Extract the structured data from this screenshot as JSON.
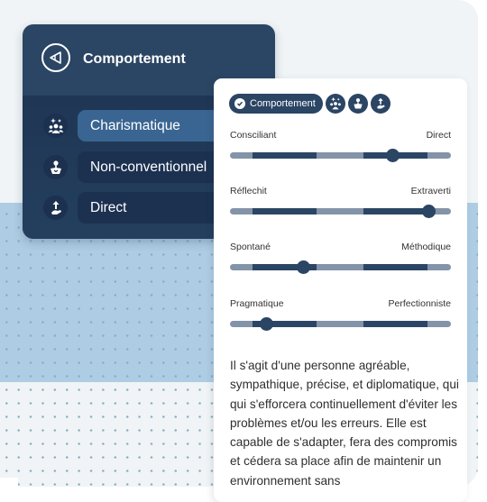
{
  "panel": {
    "title": "Comportement",
    "logo_icon": "triangle-logo-icon",
    "traits": [
      {
        "label": "Charismatique",
        "icon": "group-sparkle-icon",
        "active": true
      },
      {
        "label": "Non-conventionnel",
        "icon": "idea-box-icon",
        "active": false
      },
      {
        "label": "Direct",
        "icon": "hand-arrow-up-icon",
        "active": false
      }
    ]
  },
  "card": {
    "tag": {
      "label": "Comportement",
      "icon": "check-circle-icon"
    },
    "tag_icons": [
      "group-sparkle-icon",
      "idea-box-icon",
      "hand-arrow-up-icon"
    ],
    "sliders": [
      {
        "left": "Consciliant",
        "right": "Direct",
        "value": 0.735
      },
      {
        "left": "Réflechit",
        "right": "Extraverti",
        "value": 0.902
      },
      {
        "left": "Spontané",
        "right": "Méthodique",
        "value": 0.331
      },
      {
        "left": "Pragmatique",
        "right": "Perfectionniste",
        "value": 0.167
      }
    ],
    "description": "Il s'agit d'une personne agréable, sympathique, précise, et diplomatique, qui qui s'efforcera continuellement d'éviter les problèmes et/ou les erreurs. Elle est capable de s'adapter, fera des compromis et cédera sa place afin de maintenir un environnement sans"
  },
  "colors": {
    "navy": "#2b4564",
    "accent": "#3a6592",
    "track": "#8393a8",
    "band": "#aecde4"
  }
}
